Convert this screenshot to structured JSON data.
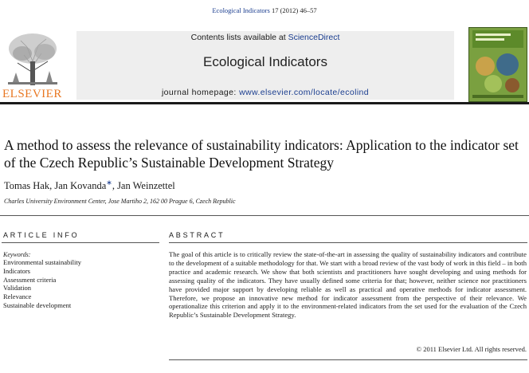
{
  "citation": {
    "journal": "Ecological Indicators",
    "issue": "17 (2012) 46–57"
  },
  "publisher": {
    "name": "ELSEVIER",
    "contents_prefix": "Contents lists available at ",
    "contents_link": "ScienceDirect",
    "journal_title": "Ecological Indicators",
    "homepage_prefix": "journal homepage: ",
    "homepage_url": "www.elsevier.com/locate/ecolind"
  },
  "article": {
    "title": "A method to assess the relevance of sustainability indicators: Application to the indicator set of the Czech Republic’s Sustainable Development Strategy",
    "author_1": "Tomas Hak, Jan Kovanda",
    "corresponding_mark": "∗",
    "author_2": ", Jan Weinzettel",
    "affiliation": "Charles University Environment Center, Jose Martiho 2, 162 00 Prague 6, Czech Republic"
  },
  "article_info": {
    "heading": "ARTICLE INFO",
    "keywords_label": "Keywords:",
    "keywords": [
      "Environmental sustainability",
      "Indicators",
      "Assessment criteria",
      "Validation",
      "Relevance",
      "Sustainable development"
    ]
  },
  "abstract": {
    "heading": "ABSTRACT",
    "text": "The goal of this article is to critically review the state-of-the-art in assessing the quality of sustainability indicators and contribute to the development of a suitable methodology for that. We start with a broad review of the vast body of work in this field – in both practice and academic research. We show that both scientists and practitioners have sought developing and using methods for assessing quality of the indicators. They have usually defined some criteria for that; however, neither science nor practitioners have provided major support by developing reliable as well as practical and operative methods for indicator assessment. Therefore, we propose an innovative new method for indicator assessment from the perspective of their relevance. We operationalize this criterion and apply it to the environment-related indicators from the set used for the evaluation of the Czech Republic’s Sustainable Development Strategy.",
    "copyright": "© 2011 Elsevier Ltd. All rights reserved."
  },
  "colors": {
    "link_blue": "#1a3d8f",
    "elsevier_orange": "#e87722",
    "masthead_grey": "#eeeeee"
  },
  "icons": {
    "publisher_logo": "elsevier-tree-logo",
    "journal_cover": "journal-cover-thumbnail"
  }
}
